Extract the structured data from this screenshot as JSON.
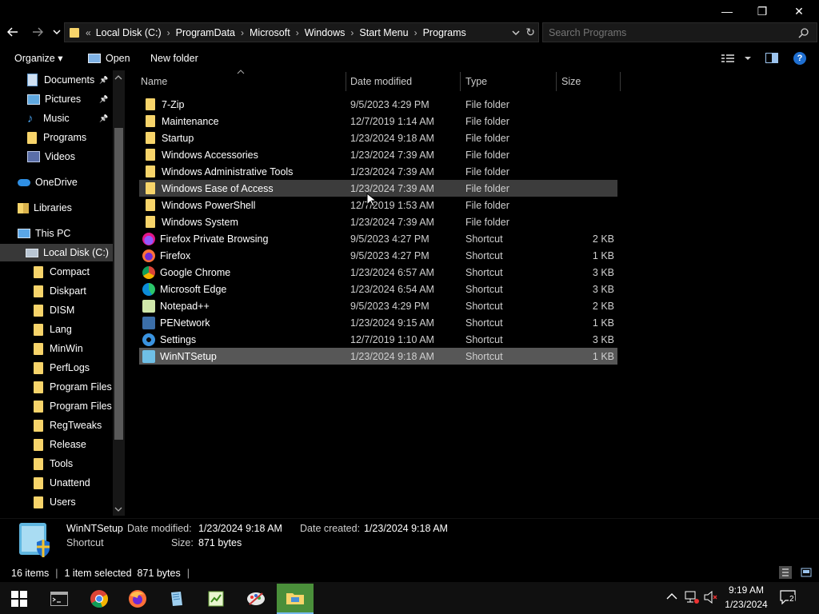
{
  "window": {
    "minimize": "—",
    "maximize": "❐",
    "close": "✕"
  },
  "address": {
    "overflow": "«",
    "crumbs": [
      "Local Disk (C:)",
      "ProgramData",
      "Microsoft",
      "Windows",
      "Start Menu",
      "Programs"
    ],
    "refresh": "↻"
  },
  "search": {
    "placeholder": "Search Programs"
  },
  "toolbar": {
    "organize": "Organize ▾",
    "open": "Open",
    "new_folder": "New folder"
  },
  "nav": {
    "items": [
      {
        "label": "Documents",
        "icon": "documents-icon",
        "pinned": true
      },
      {
        "label": "Pictures",
        "icon": "pictures-icon",
        "pinned": true
      },
      {
        "label": "Music",
        "icon": "music-icon",
        "pinned": true
      },
      {
        "label": "Programs",
        "icon": "folder-icon"
      },
      {
        "label": "Videos",
        "icon": "videos-icon"
      },
      {
        "label": "OneDrive",
        "icon": "onedrive-icon"
      },
      {
        "label": "Libraries",
        "icon": "libraries-icon"
      },
      {
        "label": "This PC",
        "icon": "this-pc-icon"
      },
      {
        "label": "Local Disk (C:)",
        "icon": "drive-icon"
      },
      {
        "label": "Compact",
        "icon": "folder-icon"
      },
      {
        "label": "Diskpart",
        "icon": "folder-icon"
      },
      {
        "label": "DISM",
        "icon": "folder-icon"
      },
      {
        "label": "Lang",
        "icon": "folder-icon"
      },
      {
        "label": "MinWin",
        "icon": "folder-icon"
      },
      {
        "label": "PerfLogs",
        "icon": "folder-icon"
      },
      {
        "label": "Program Files",
        "icon": "folder-icon"
      },
      {
        "label": "Program Files (",
        "icon": "folder-icon"
      },
      {
        "label": "RegTweaks",
        "icon": "folder-icon"
      },
      {
        "label": "Release",
        "icon": "folder-icon"
      },
      {
        "label": "Tools",
        "icon": "folder-icon"
      },
      {
        "label": "Unattend",
        "icon": "folder-icon"
      },
      {
        "label": "Users",
        "icon": "folder-icon"
      }
    ]
  },
  "columns": {
    "name": "Name",
    "date": "Date modified",
    "type": "Type",
    "size": "Size"
  },
  "files": [
    {
      "name": "7-Zip",
      "date": "9/5/2023 4:29 PM",
      "type": "File folder",
      "size": "",
      "icon": "folder-icon"
    },
    {
      "name": "Maintenance",
      "date": "12/7/2019 1:14 AM",
      "type": "File folder",
      "size": "",
      "icon": "folder-icon"
    },
    {
      "name": "Startup",
      "date": "1/23/2024 9:18 AM",
      "type": "File folder",
      "size": "",
      "icon": "folder-icon"
    },
    {
      "name": "Windows Accessories",
      "date": "1/23/2024 7:39 AM",
      "type": "File folder",
      "size": "",
      "icon": "folder-icon"
    },
    {
      "name": "Windows Administrative Tools",
      "date": "1/23/2024 7:39 AM",
      "type": "File folder",
      "size": "",
      "icon": "folder-icon"
    },
    {
      "name": "Windows Ease of Access",
      "date": "1/23/2024 7:39 AM",
      "type": "File folder",
      "size": "",
      "icon": "folder-icon"
    },
    {
      "name": "Windows PowerShell",
      "date": "12/7/2019 1:53 AM",
      "type": "File folder",
      "size": "",
      "icon": "folder-icon"
    },
    {
      "name": "Windows System",
      "date": "1/23/2024 7:39 AM",
      "type": "File folder",
      "size": "",
      "icon": "folder-icon"
    },
    {
      "name": "Firefox Private Browsing",
      "date": "9/5/2023 4:27 PM",
      "type": "Shortcut",
      "size": "2 KB",
      "icon": "firefox-private-icon"
    },
    {
      "name": "Firefox",
      "date": "9/5/2023 4:27 PM",
      "type": "Shortcut",
      "size": "1 KB",
      "icon": "firefox-icon"
    },
    {
      "name": "Google Chrome",
      "date": "1/23/2024 6:57 AM",
      "type": "Shortcut",
      "size": "3 KB",
      "icon": "chrome-icon"
    },
    {
      "name": "Microsoft Edge",
      "date": "1/23/2024 6:54 AM",
      "type": "Shortcut",
      "size": "3 KB",
      "icon": "edge-icon"
    },
    {
      "name": "Notepad++",
      "date": "9/5/2023 4:29 PM",
      "type": "Shortcut",
      "size": "2 KB",
      "icon": "notepadpp-icon"
    },
    {
      "name": "PENetwork",
      "date": "1/23/2024 9:15 AM",
      "type": "Shortcut",
      "size": "1 KB",
      "icon": "penetwork-icon"
    },
    {
      "name": "Settings",
      "date": "12/7/2019 1:10 AM",
      "type": "Shortcut",
      "size": "3 KB",
      "icon": "settings-icon"
    },
    {
      "name": "WinNTSetup",
      "date": "1/23/2024 9:18 AM",
      "type": "Shortcut",
      "size": "1 KB",
      "icon": "winntsetup-icon"
    }
  ],
  "details": {
    "name": "WinNTSetup",
    "kind": "Shortcut",
    "modified_label": "Date modified:",
    "modified": "1/23/2024 9:18 AM",
    "created_label": "Date created:",
    "created": "1/23/2024 9:18 AM",
    "size_label": "Size:",
    "size": "871 bytes"
  },
  "status": {
    "count": "16 items",
    "selected": "1 item selected  871 bytes"
  },
  "taskbar": {
    "time": "9:19 AM",
    "date": "1/23/2024",
    "notifications": "2"
  },
  "colors": {
    "accent": "#76b9ed",
    "folder": "#f7d46a",
    "selected_row": "#575757",
    "hover_row": "#3c3c3c"
  }
}
